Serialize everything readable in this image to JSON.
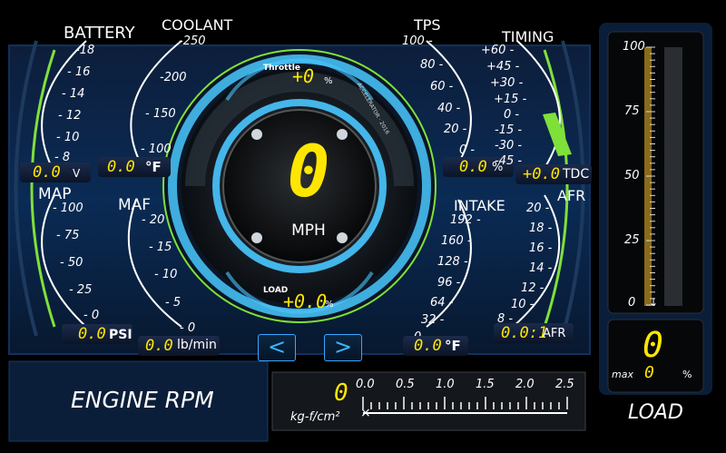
{
  "gauges": {
    "battery": {
      "title": "BATTERY",
      "ticks": [
        "-18",
        "- 16",
        "- 14",
        "- 12",
        "- 10",
        "- 8"
      ],
      "value": "0.0",
      "unit": "V"
    },
    "coolant": {
      "title": "COOLANT",
      "ticks": [
        "-250",
        "-200",
        "- 150",
        "- 100"
      ],
      "value": "0.0",
      "unit": "°F"
    },
    "map": {
      "title": "MAP",
      "ticks": [
        "- 100",
        "- 75",
        "- 50",
        "- 25",
        "- 0"
      ],
      "value": "0.0",
      "unit": "PSI"
    },
    "maf": {
      "title": "MAF",
      "ticks": [
        "- 20",
        "- 15",
        "- 10",
        "- 5",
        "- 0"
      ],
      "value": "0.0",
      "unit": "lb/min"
    },
    "tps": {
      "title": "TPS",
      "ticks": [
        "100 -",
        "80 -",
        "60 -",
        "40 -",
        "20 -",
        "0 -"
      ],
      "value": "0.0",
      "unit": "%"
    },
    "timing": {
      "title": "TIMING",
      "ticks": [
        "+60 -",
        "+45 -",
        "+30 -",
        "+15 -",
        "0 -",
        "-15 -",
        "-30 -",
        "-45 -"
      ],
      "value": "+0.0",
      "unit": "TDC"
    },
    "intake": {
      "title": "INTAKE",
      "ticks": [
        "192 -",
        "160 -",
        "128 -",
        "96 -",
        "64 -",
        "32 -",
        "0 -"
      ],
      "value": "0.0",
      "unit": "°F"
    },
    "afr": {
      "title": "AFR",
      "ticks": [
        "20 -",
        "18 -",
        "16 -",
        "14 -",
        "12 -",
        "10 -",
        "8 -"
      ],
      "value": "0.0:1",
      "unit": "AFR"
    }
  },
  "center": {
    "throttle_label": "Throttle",
    "throttle_value": "+0",
    "throttle_unit": "%",
    "speed_value": "0",
    "speed_unit": "MPH",
    "load_label": "LOAD",
    "load_value": "+0.0",
    "load_unit": "%",
    "top_right_text": "ACCELERATOR · 2016"
  },
  "nav": {
    "prev": "<",
    "next": ">"
  },
  "bottom": {
    "rpm_title": "ENGINE RPM",
    "boost_value": "0",
    "boost_unit": "kg-f/cm²",
    "boost_scale": [
      "0.0",
      "0.5",
      "1.0",
      "1.5",
      "2.0",
      "2.5"
    ],
    "boost_level": 0
  },
  "load_panel": {
    "ticks": [
      "100",
      "75",
      "50",
      "25",
      "0"
    ],
    "value": "0",
    "max_label": "max",
    "max_value": "0",
    "pct": "%",
    "title": "LOAD",
    "level": 0
  },
  "colors": {
    "accent": "#ffe600",
    "cyan": "#39c3ff",
    "green": "#7fe03a"
  }
}
